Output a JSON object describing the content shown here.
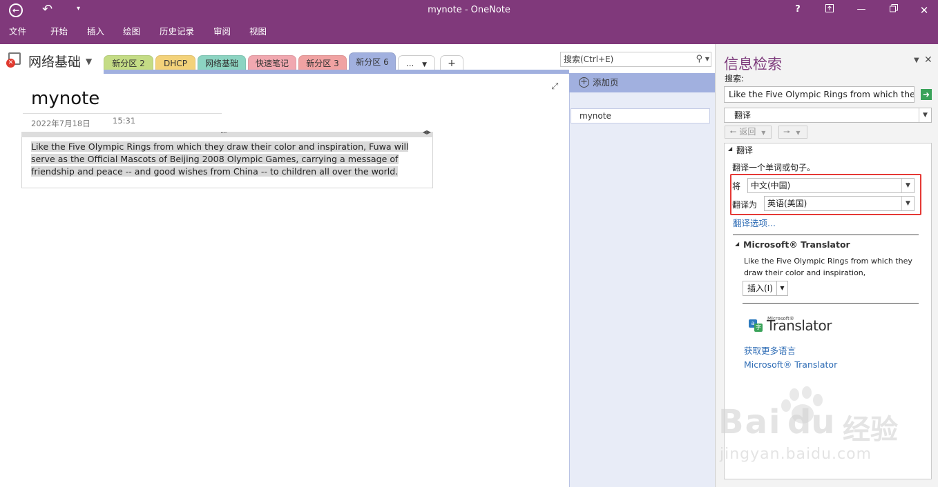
{
  "titlebar": {
    "title": "mynote - OneNote",
    "back_icon": "back-circle-icon",
    "undo_icon": "undo-icon",
    "customize_icon": "customize-quick-access-icon",
    "help": "?",
    "menus": [
      "文件",
      "开始",
      "插入",
      "绘图",
      "历史记录",
      "审阅",
      "视图"
    ]
  },
  "notebook": {
    "name": "网络基础",
    "tabs": [
      {
        "label": "新分区 2",
        "color": "#c4dc85"
      },
      {
        "label": "DHCP",
        "color": "#f3d27a"
      },
      {
        "label": "网络基础",
        "color": "#8cd4c2"
      },
      {
        "label": "快速笔记",
        "color": "#f1a8b0"
      },
      {
        "label": "新分区 3",
        "color": "#f0a2a2"
      },
      {
        "label": "新分区 6",
        "color": "#a1b0df"
      }
    ],
    "more_label": "...",
    "add_tab": "+",
    "search_placeholder": "搜索(Ctrl+E)"
  },
  "page": {
    "title": "mynote",
    "date": "2022年7月18日",
    "time": "15:31",
    "body": "Like the Five Olympic Rings from which they draw their color and inspiration, Fuwa will serve as the Official Mascots of Beijing 2008 Olympic Games, carrying a message of friendship and peace -- and good wishes from China -- to children all over the world."
  },
  "pages_panel": {
    "add_page": "添加页",
    "items": [
      "mynote"
    ]
  },
  "research": {
    "heading": "信息检索",
    "search_label": "搜索:",
    "search_value": "Like the Five Olympic Rings from which they c",
    "service": "翻译",
    "back_label": "返回",
    "section_translate": "翻译",
    "instruction": "翻译一个单词或句子。",
    "from_label": "将",
    "from_value": "中文(中国)",
    "to_label": "翻译为",
    "to_value": "英语(美国)",
    "options_link": "翻译选项...",
    "ms_heading": "Microsoft® Translator",
    "result": "Like the Five Olympic Rings from which they draw their color and inspiration,",
    "insert_label": "插入(I)",
    "logo_small": "Microsoft®",
    "logo_big": "Translator",
    "more_languages": "获取更多语言",
    "ms_link": "Microsoft® Translator"
  },
  "watermark": {
    "brand": "Bai",
    "brand2": "du",
    "cn": "经验",
    "url": "jingyan.baidu.com"
  },
  "colors": {
    "accent": "#80397b",
    "highlight_box": "#e53935",
    "link": "#2e6cb5"
  }
}
